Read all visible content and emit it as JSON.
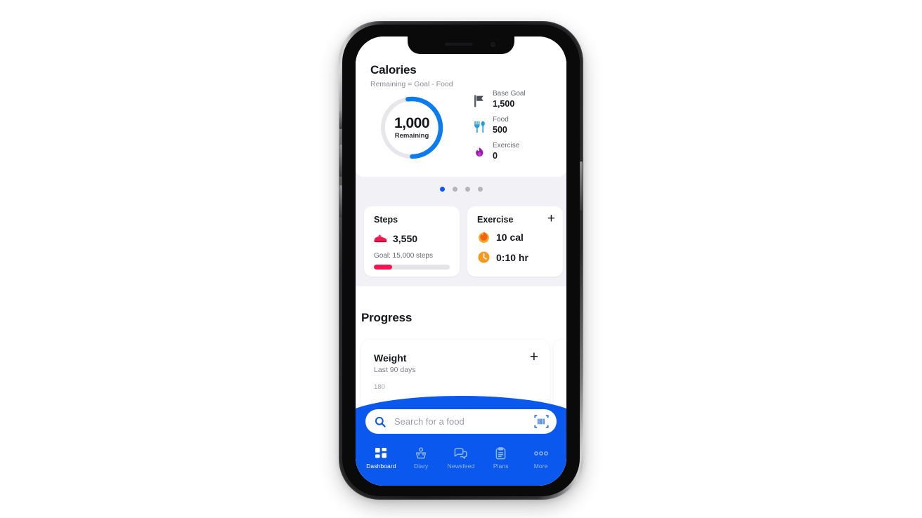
{
  "app": {
    "calories_card": {
      "title": "Calories",
      "subtitle": "Remaining = Goal - Food",
      "ring": {
        "value": "1,000",
        "label": "Remaining",
        "percent": 50,
        "track_color": "#e6e6eb",
        "arc_color": "#0a7cf0"
      },
      "stats": [
        {
          "icon": "flag-icon",
          "name": "Base Goal",
          "value": "1,500",
          "color": "#4b4f56"
        },
        {
          "icon": "utensils-icon",
          "name": "Food",
          "value": "500",
          "color": "#2a9bdd"
        },
        {
          "icon": "flame-icon",
          "name": "Exercise",
          "value": "0",
          "color": "#9a1fa8"
        }
      ]
    },
    "pager": {
      "count": 4,
      "active_index": 0,
      "active_color": "#0a58ed",
      "inactive_color": "#b4b6bb"
    },
    "steps_card": {
      "title": "Steps",
      "icon": "sneaker-icon",
      "value": "3,550",
      "goal_text": "Goal: 15,000 steps",
      "progress_percent": 24,
      "progress_color": "#f5164f"
    },
    "exercise_card": {
      "title": "Exercise",
      "add_label": "+",
      "calories": {
        "icon": "flame-icon",
        "value": "10 cal",
        "color": "#f59a1e"
      },
      "duration": {
        "icon": "clock-icon",
        "value": "0:10 hr",
        "color": "#f59a1e"
      }
    },
    "progress_section": {
      "title": "Progress",
      "weight_card": {
        "title": "Weight",
        "subtitle": "Last 90 days",
        "add_label": "+",
        "axis_label": "180"
      }
    },
    "search": {
      "placeholder": "Search for a food",
      "value": "",
      "icon": "search-icon",
      "scan_icon": "barcode-scan-icon"
    },
    "tabbar": {
      "accent_color": "#0a58ed",
      "items": [
        {
          "label": "Dashboard",
          "icon": "grid-icon",
          "active": true
        },
        {
          "label": "Diary",
          "icon": "diary-icon",
          "active": false
        },
        {
          "label": "Newsfeed",
          "icon": "chat-icon",
          "active": false
        },
        {
          "label": "Plans",
          "icon": "clipboard-icon",
          "active": false
        },
        {
          "label": "More",
          "icon": "ellipsis-icon",
          "active": false
        }
      ]
    }
  }
}
